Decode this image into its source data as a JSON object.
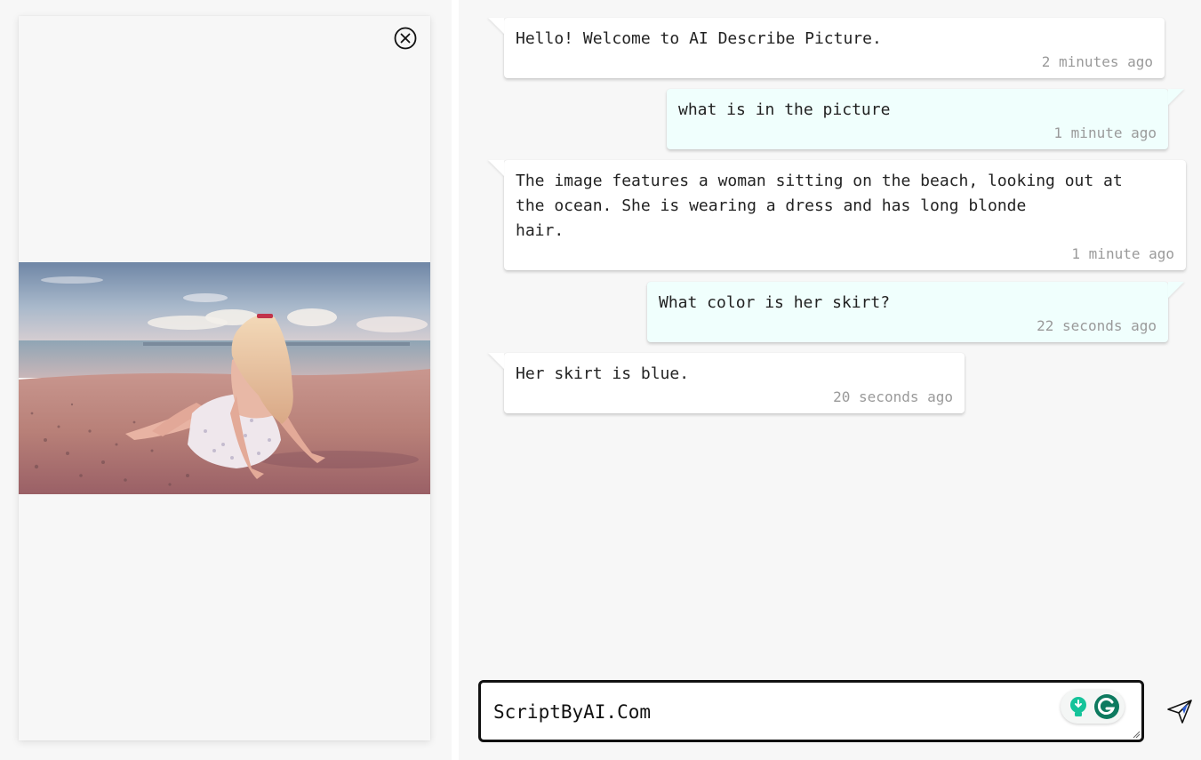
{
  "image_panel": {
    "close_icon": "close-circle-icon",
    "photo_description_icon": "beach-photo"
  },
  "messages": [
    {
      "role": "bot",
      "text": "Hello! Welcome to AI Describe Picture.",
      "time": "2 minutes ago"
    },
    {
      "role": "user",
      "text": "what is in the picture",
      "time": "1 minute ago"
    },
    {
      "role": "bot",
      "text": "The image features a woman sitting on the beach, looking out at\nthe ocean. She is wearing a dress and has long blonde\nhair.",
      "time": "1 minute ago"
    },
    {
      "role": "user",
      "text": "What color is her skirt?",
      "time": "22 seconds ago"
    },
    {
      "role": "bot",
      "text": "Her skirt is blue.",
      "time": "20 seconds ago"
    }
  ],
  "input": {
    "value": "ScriptByAI.Com",
    "send_icon": "send-paper-plane-icon"
  },
  "colors": {
    "page_bg": "#f7f7f7",
    "bot_bubble": "#ffffff",
    "user_bubble": "#f0fffd",
    "timestamp": "#9a9a9a",
    "grammarly_green": "#15c39a"
  }
}
